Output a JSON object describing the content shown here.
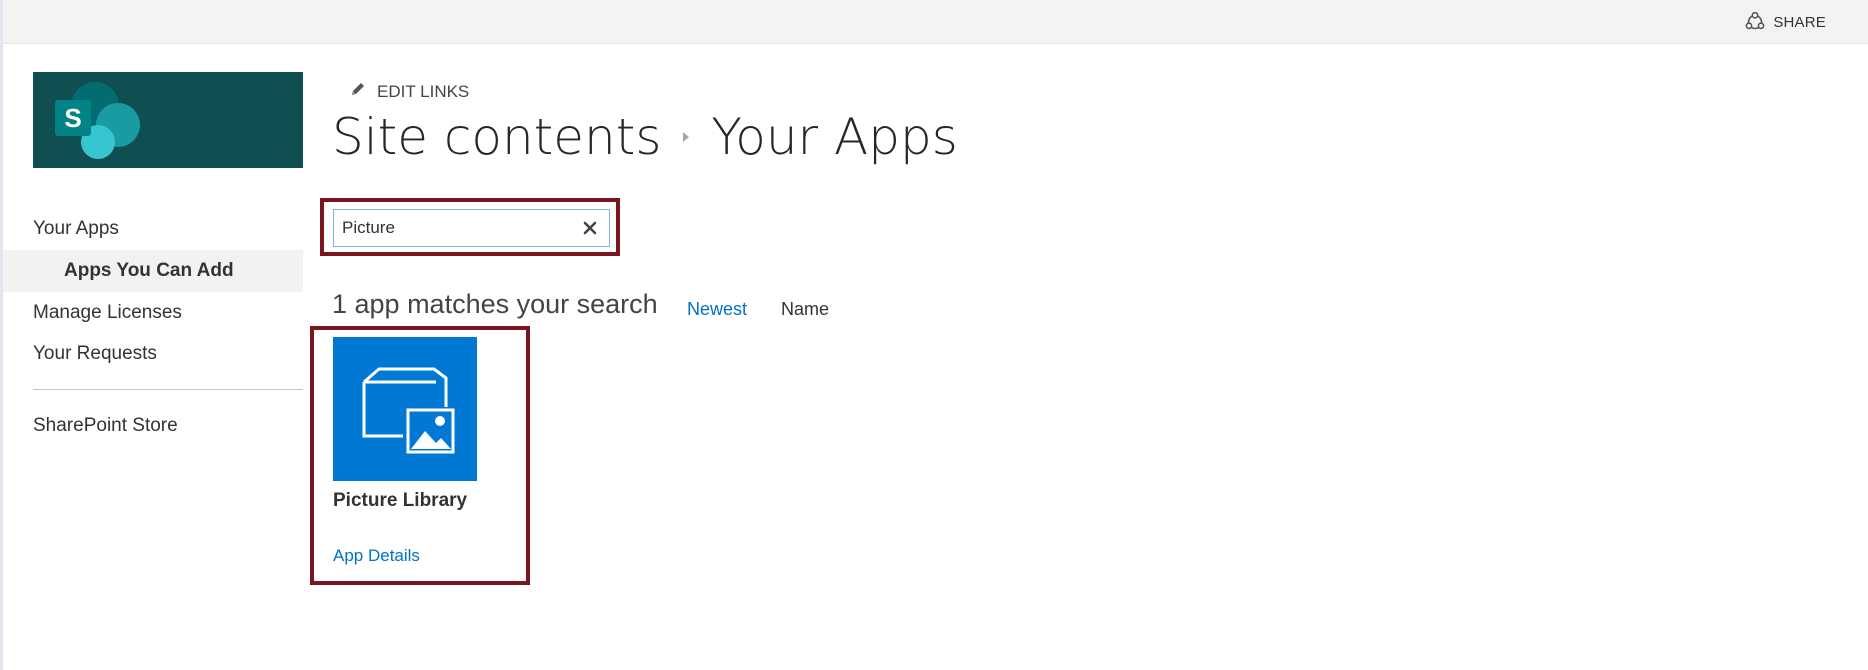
{
  "topbar": {
    "share_label": "SHARE",
    "share_icon": "share-icon"
  },
  "logo": {
    "icon": "sharepoint-logo",
    "letter": "S",
    "background_color": "#0f4f52"
  },
  "nav": {
    "items": [
      {
        "label": "Your Apps"
      },
      {
        "label": "Apps You Can Add",
        "selected": true
      },
      {
        "label": "Manage Licenses"
      },
      {
        "label": "Your Requests"
      },
      {
        "label": "SharePoint Store"
      }
    ]
  },
  "edit_links": {
    "label": "EDIT LINKS",
    "icon": "pencil-icon"
  },
  "breadcrumb": {
    "parent": "Site contents",
    "current": "Your Apps",
    "separator_icon": "chevron-right-icon"
  },
  "search": {
    "value": "Picture",
    "clear_icon": "close-icon"
  },
  "results": {
    "count_text": "1 app matches your search",
    "sort_options": [
      {
        "label": "Newest",
        "active": true
      },
      {
        "label": "Name",
        "active": false
      }
    ]
  },
  "apps": [
    {
      "name": "Picture Library",
      "details_link": "App Details",
      "icon": "picture-library-icon",
      "tile_color": "#0078d4"
    }
  ],
  "colors": {
    "accent_link": "#0072c6",
    "highlight_border": "#7a1520"
  }
}
